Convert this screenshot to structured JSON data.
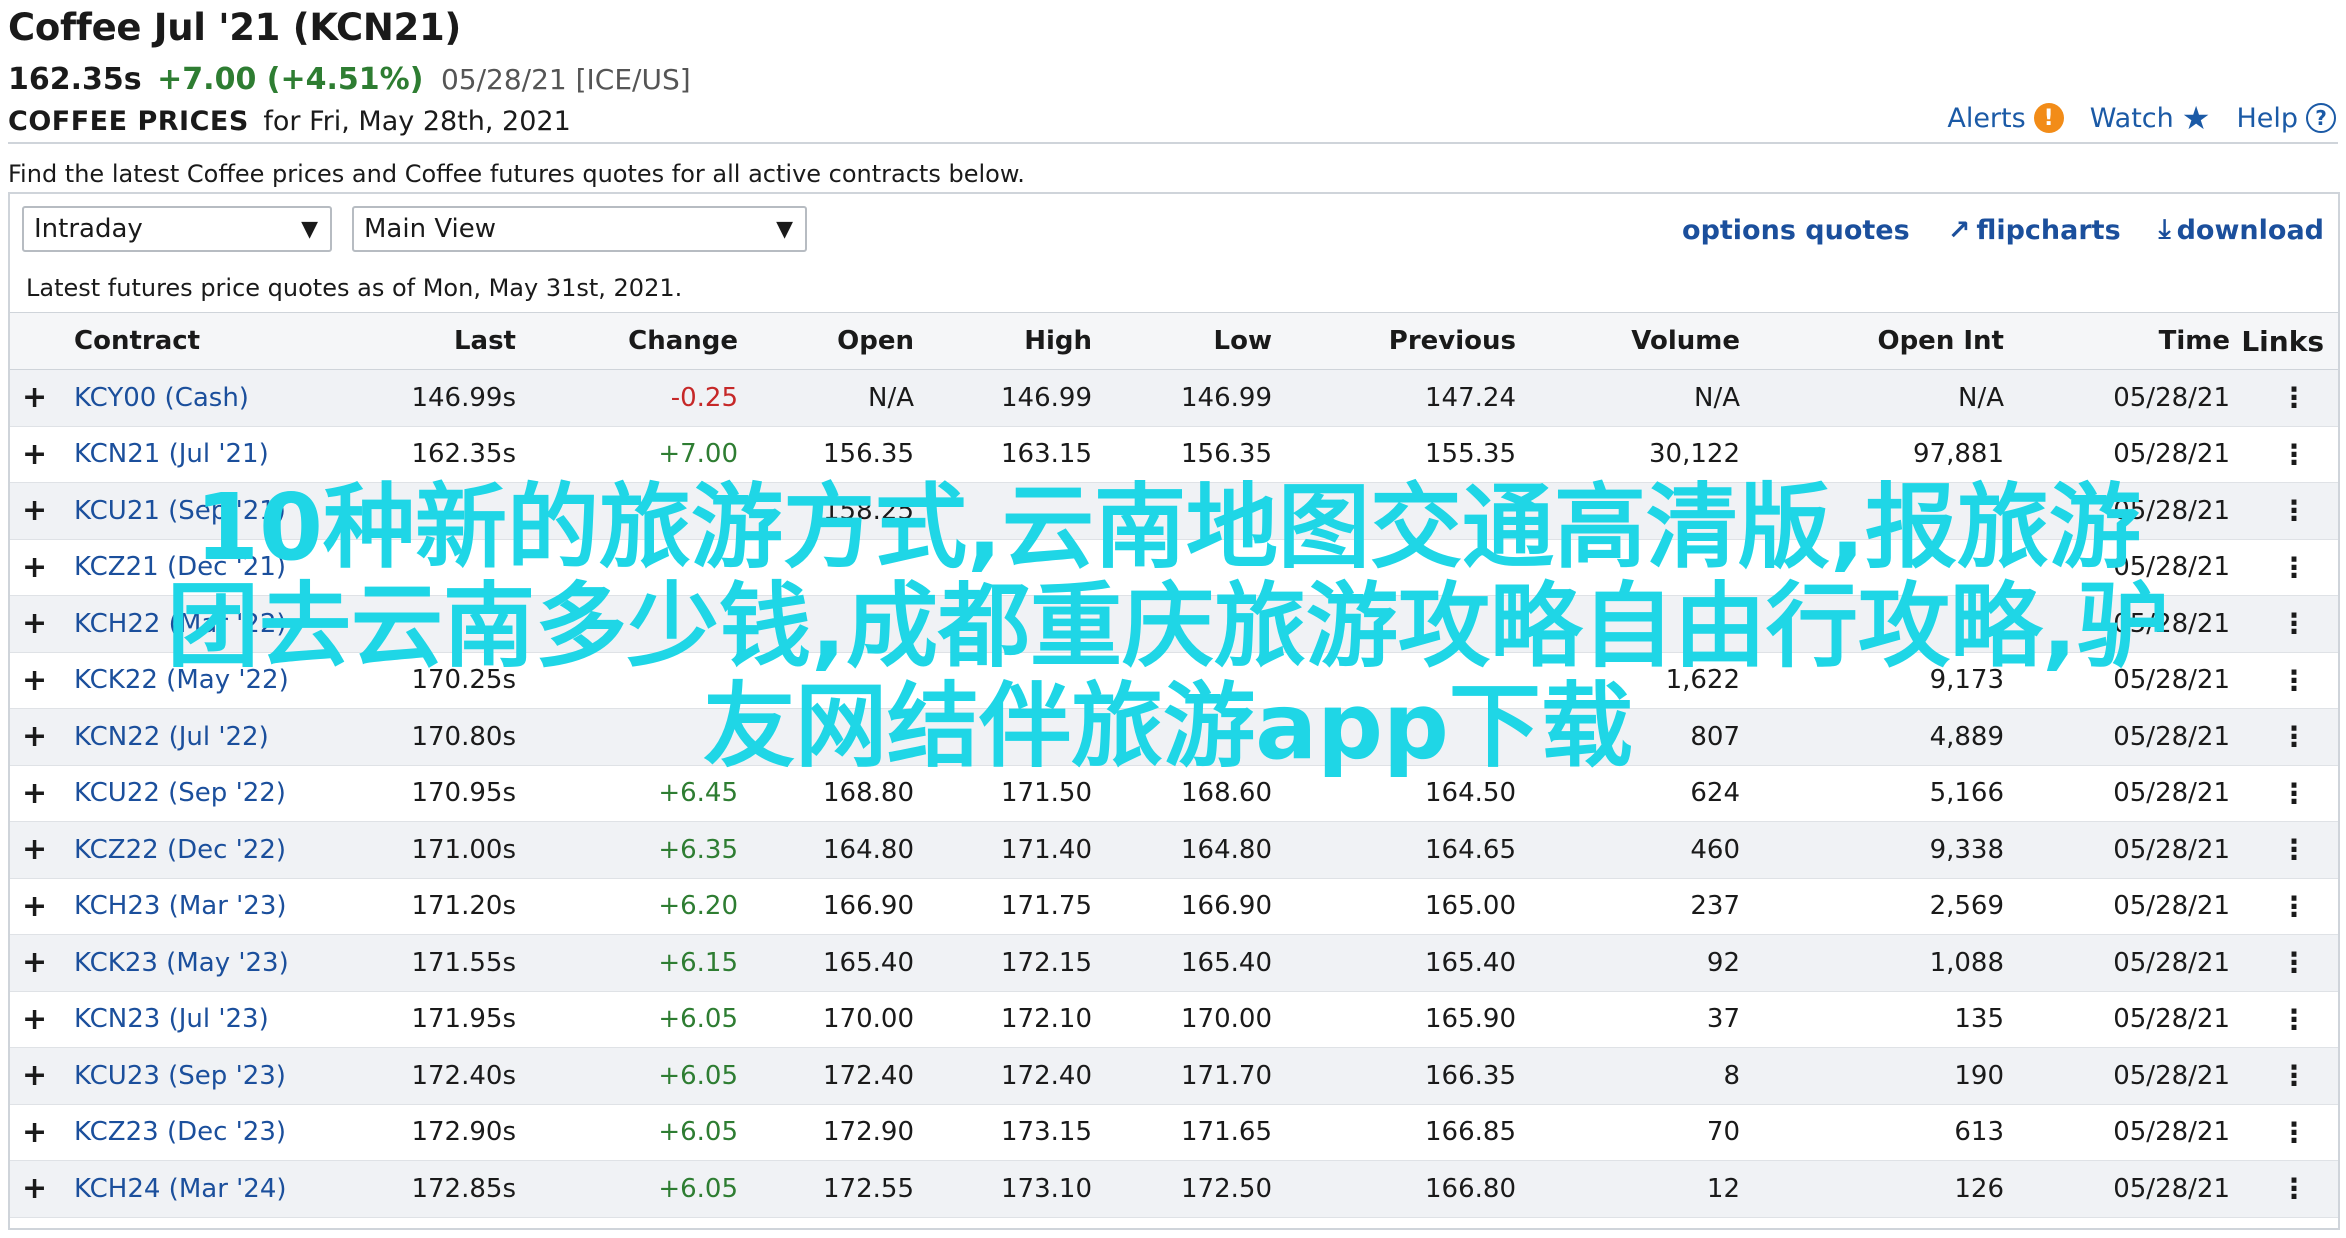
{
  "header": {
    "title": "Coffee Jul '21 (KCN21)",
    "price": "162.35s",
    "change": "+7.00 (+4.51%)",
    "date_exchange": "05/28/21 [ICE/US]",
    "section_caps": "COFFEE PRICES",
    "section_date": "for Fri, May 28th, 2021"
  },
  "top_links": {
    "alerts": "Alerts",
    "watch": "Watch",
    "help": "Help"
  },
  "description": "Find the latest Coffee prices and Coffee futures quotes for all active contracts below.",
  "controls": {
    "period_select": "Intraday",
    "view_select": "Main View",
    "options_quotes": "options quotes",
    "flipcharts": "flipcharts",
    "download": "download"
  },
  "as_of": "Latest futures price quotes as of Mon, May 31st, 2021.",
  "table": {
    "columns": [
      "Contract",
      "Last",
      "Change",
      "Open",
      "High",
      "Low",
      "Previous",
      "Volume",
      "Open Int",
      "Time",
      "Links"
    ],
    "rows": [
      {
        "contract": "KCY00 (Cash)",
        "last": "146.99s",
        "change": "-0.25",
        "open": "N/A",
        "high": "146.99",
        "low": "146.99",
        "prev": "147.24",
        "vol": "N/A",
        "oi": "N/A",
        "time": "05/28/21"
      },
      {
        "contract": "KCN21 (Jul '21)",
        "last": "162.35s",
        "change": "+7.00",
        "open": "156.35",
        "high": "163.15",
        "low": "156.35",
        "prev": "155.35",
        "vol": "30,122",
        "oi": "97,881",
        "time": "05/28/21"
      },
      {
        "contract": "KCU21 (Sep '21)",
        "last": "",
        "change": "",
        "open": "158.25",
        "high": "",
        "low": "",
        "prev": "",
        "vol": "",
        "oi": "",
        "time": "05/28/21"
      },
      {
        "contract": "KCZ21 (Dec '21)",
        "last": "",
        "change": "",
        "open": "",
        "high": "",
        "low": "",
        "prev": "",
        "vol": "",
        "oi": "",
        "time": "05/28/21"
      },
      {
        "contract": "KCH22 (Mar '22)",
        "last": "",
        "change": "",
        "open": "",
        "high": "",
        "low": "",
        "prev": "",
        "vol": "",
        "oi": "",
        "time": "05/28/21"
      },
      {
        "contract": "KCK22 (May '22)",
        "last": "170.25s",
        "change": "",
        "open": "",
        "high": "",
        "low": "",
        "prev": "",
        "vol": "1,622",
        "oi": "9,173",
        "time": "05/28/21"
      },
      {
        "contract": "KCN22 (Jul '22)",
        "last": "170.80s",
        "change": "",
        "open": "",
        "high": "",
        "low": "",
        "prev": "",
        "vol": "807",
        "oi": "4,889",
        "time": "05/28/21"
      },
      {
        "contract": "KCU22 (Sep '22)",
        "last": "170.95s",
        "change": "+6.45",
        "open": "168.80",
        "high": "171.50",
        "low": "168.60",
        "prev": "164.50",
        "vol": "624",
        "oi": "5,166",
        "time": "05/28/21"
      },
      {
        "contract": "KCZ22 (Dec '22)",
        "last": "171.00s",
        "change": "+6.35",
        "open": "164.80",
        "high": "171.40",
        "low": "164.80",
        "prev": "164.65",
        "vol": "460",
        "oi": "9,338",
        "time": "05/28/21"
      },
      {
        "contract": "KCH23 (Mar '23)",
        "last": "171.20s",
        "change": "+6.20",
        "open": "166.90",
        "high": "171.75",
        "low": "166.90",
        "prev": "165.00",
        "vol": "237",
        "oi": "2,569",
        "time": "05/28/21"
      },
      {
        "contract": "KCK23 (May '23)",
        "last": "171.55s",
        "change": "+6.15",
        "open": "165.40",
        "high": "172.15",
        "low": "165.40",
        "prev": "165.40",
        "vol": "92",
        "oi": "1,088",
        "time": "05/28/21"
      },
      {
        "contract": "KCN23 (Jul '23)",
        "last": "171.95s",
        "change": "+6.05",
        "open": "170.00",
        "high": "172.10",
        "low": "170.00",
        "prev": "165.90",
        "vol": "37",
        "oi": "135",
        "time": "05/28/21"
      },
      {
        "contract": "KCU23 (Sep '23)",
        "last": "172.40s",
        "change": "+6.05",
        "open": "172.40",
        "high": "172.40",
        "low": "171.70",
        "prev": "166.35",
        "vol": "8",
        "oi": "190",
        "time": "05/28/21"
      },
      {
        "contract": "KCZ23 (Dec '23)",
        "last": "172.90s",
        "change": "+6.05",
        "open": "172.90",
        "high": "173.15",
        "low": "171.65",
        "prev": "166.85",
        "vol": "70",
        "oi": "613",
        "time": "05/28/21"
      },
      {
        "contract": "KCH24 (Mar '24)",
        "last": "172.85s",
        "change": "+6.05",
        "open": "172.55",
        "high": "173.10",
        "low": "172.50",
        "prev": "166.80",
        "vol": "12",
        "oi": "126",
        "time": "05/28/21"
      }
    ]
  },
  "overlay": {
    "line1": "10种新的旅游方式,云南地图交通高清版,报旅游",
    "line2": "团去云南多少钱,成都重庆旅游攻略自由行攻略,驴",
    "line3": "友网结伴旅游app下载"
  },
  "colors": {
    "link": "#1b4f9c",
    "positive": "#2e7d32",
    "negative": "#c62828",
    "overlay": "#1fd6e6",
    "alert_badge": "#f28c18"
  }
}
